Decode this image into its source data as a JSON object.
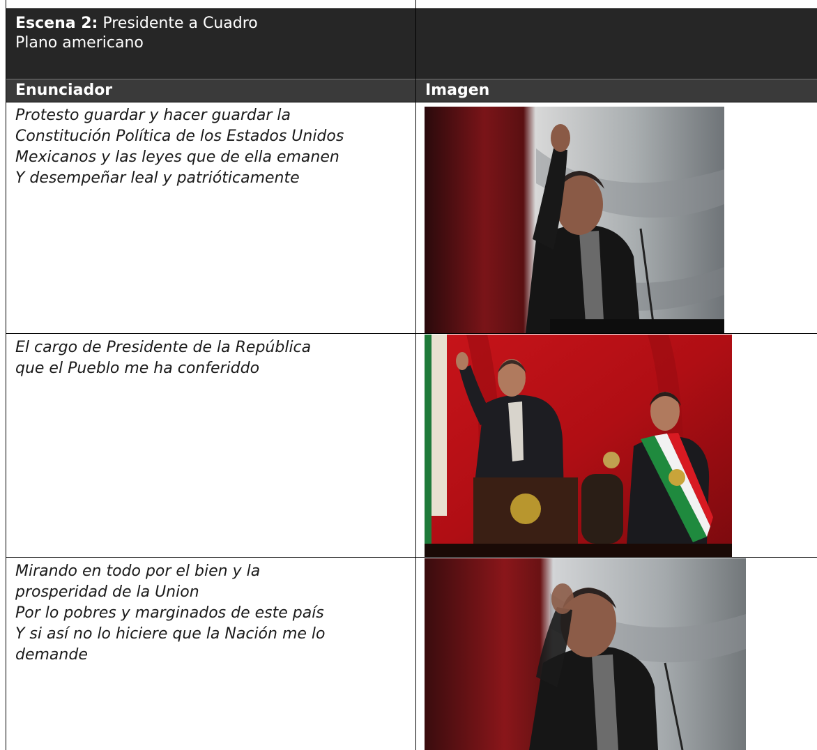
{
  "scene": {
    "label": "Escena 2:",
    "title": "Presidente a Cuadro",
    "shot_type": "Plano americano"
  },
  "columns": {
    "speaker": "Enunciador",
    "image": "Imagen"
  },
  "rows": [
    {
      "lines": [
        "Protesto guardar y hacer guardar la",
        "Constitución Política de los Estados Unidos",
        "Mexicanos y las leyes que de ella emanen",
        "Y desempeñar leal y patrióticamente"
      ]
    },
    {
      "lines": [
        "El cargo de Presidente de la República",
        "que el Pueblo me ha conferiddo"
      ]
    },
    {
      "lines": [
        "Mirando en todo por el bien y la",
        "prosperidad de la Union",
        "Por lo pobres y marginados de este país",
        "Y si así no lo hiciere que la Nación me lo",
        "demande"
      ]
    }
  ]
}
